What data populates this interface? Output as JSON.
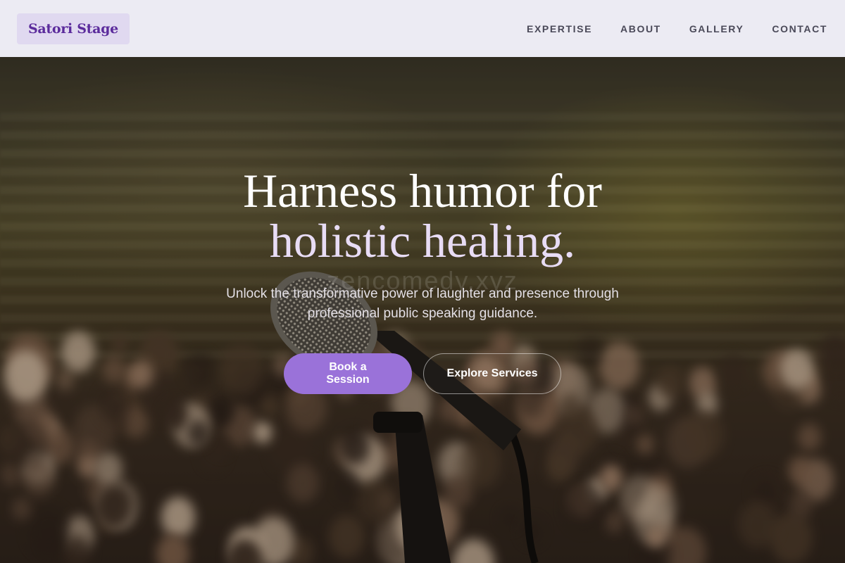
{
  "brand": {
    "name": "Satori Stage"
  },
  "nav": {
    "items": [
      {
        "label": "EXPERTISE"
      },
      {
        "label": "ABOUT"
      },
      {
        "label": "GALLERY"
      },
      {
        "label": "CONTACT"
      }
    ]
  },
  "hero": {
    "headline_line1": "Harness humor for",
    "headline_line2": "holistic healing.",
    "watermark": "zencomedy.xyz",
    "subtitle": "Unlock the transformative power of laughter and presence through professional public speaking guidance.",
    "primary_button": "Book a Session",
    "secondary_button": "Explore Services"
  },
  "colors": {
    "accent": "#9a72d9",
    "brand_text": "#5b2b9c",
    "nav_bg": "#ecebf3"
  }
}
